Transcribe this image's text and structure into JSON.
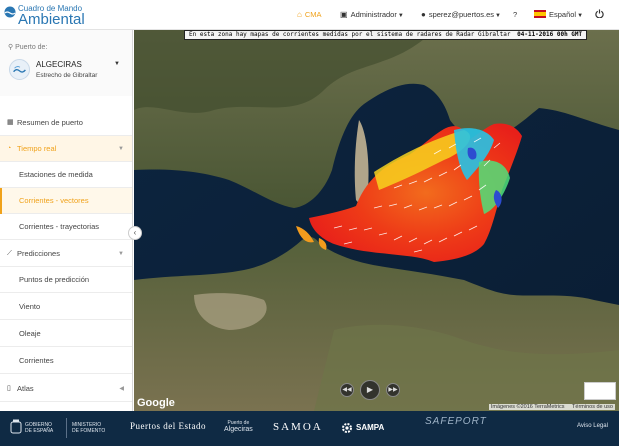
{
  "header": {
    "logo_line1": "Cuadro de Mando",
    "logo_line2": "Ambiental",
    "nav": {
      "cma": "CMA",
      "admin": "Administrador",
      "user": "sperez@puertos.es",
      "help": "?",
      "language": "Español"
    }
  },
  "sidebar": {
    "port_label": "Puerto de:",
    "port_name": "ALGECIRAS",
    "port_sub": "Estrecho de Gibraltar",
    "items": [
      {
        "label": "Resumen de puerto"
      },
      {
        "label": "Tiempo real"
      },
      {
        "label": "Estaciones de medida"
      },
      {
        "label": "Corrientes - vectores"
      },
      {
        "label": "Corrientes - trayectorias"
      },
      {
        "label": "Predicciones"
      },
      {
        "label": "Puntos de predicción"
      },
      {
        "label": "Viento"
      },
      {
        "label": "Oleaje"
      },
      {
        "label": "Corrientes"
      },
      {
        "label": "Atlas"
      }
    ]
  },
  "map": {
    "banner_text": "En esta zona hay mapas de corrientes medidas por el sistema de radares de Radar Gibraltar",
    "banner_date": "04-11-2016 00h GMT",
    "attribution": "Imágenes ©2016 TerraMetrics",
    "terms": "Términos de uso",
    "google": "Google"
  },
  "footer": {
    "gob1": "GOBIERNO",
    "gob2": "DE ESPAÑA",
    "min1": "MINISTERIO",
    "min2": "DE FOMENTO",
    "pde": "Puertos del Estado",
    "alg1": "Puerto de",
    "alg2": "Algeciras",
    "samoa": "SAMOA",
    "sampa": "SAMPA",
    "safeport": "SAFEPORT",
    "legal": "Aviso Legal"
  },
  "colors": {
    "accent": "#f0a21b",
    "brand_blue": "#2a77b3",
    "footer_bg": "#0f2a44"
  }
}
